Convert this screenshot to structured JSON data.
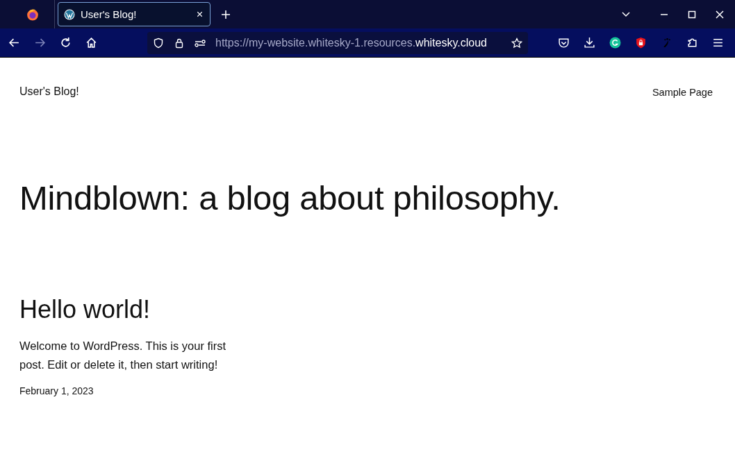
{
  "browser": {
    "tabs": [
      {
        "title": "User's Blog!",
        "selected": true
      }
    ],
    "url": {
      "prefix": "https://my-website.whitesky-1.resources.",
      "domain": "whitesky.cloud"
    }
  },
  "site": {
    "title": "User's Blog!",
    "nav": [
      "Sample Page"
    ],
    "tagline": "Mindblown: a blog about philosophy."
  },
  "posts": [
    {
      "title": "Hello world!",
      "excerpt": "Welcome to WordPress. This is your first post. Edit or delete it, then start writing!",
      "date": "February 1, 2023"
    }
  ]
}
